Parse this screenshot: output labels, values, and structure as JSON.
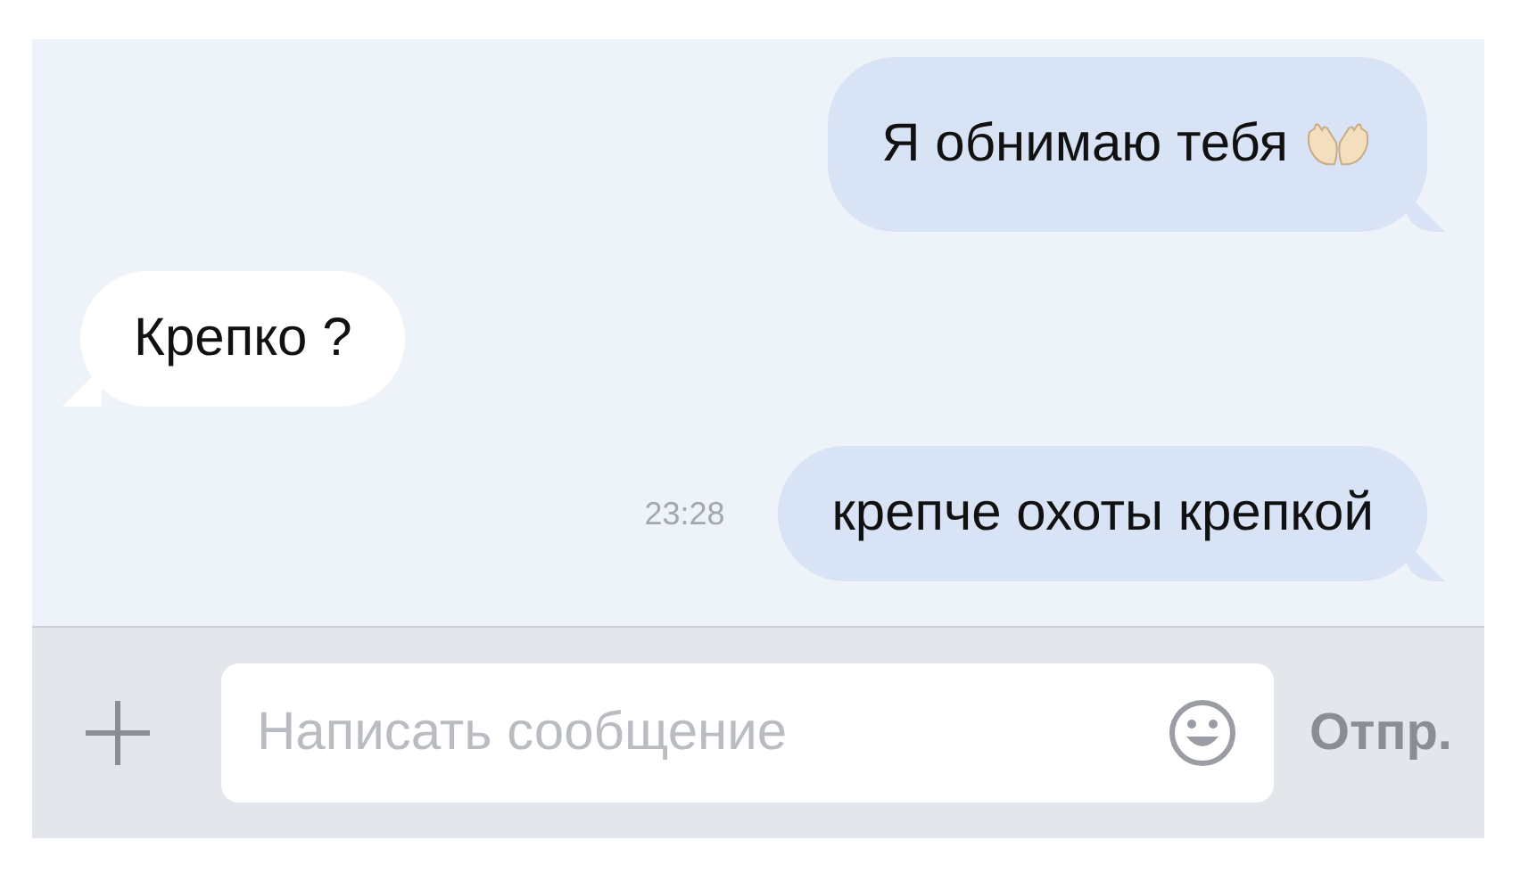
{
  "messages": [
    {
      "kind": "outgoing",
      "text": "Я обнимаю тебя",
      "emoji": true
    },
    {
      "kind": "incoming",
      "text": "Крепко ?",
      "emoji": false
    },
    {
      "kind": "outgoing",
      "text": "крепче охоты крепкой",
      "emoji": false,
      "time": "23:28"
    }
  ],
  "composer": {
    "placeholder": "Написать сообщение",
    "send_label": "Отпр."
  }
}
